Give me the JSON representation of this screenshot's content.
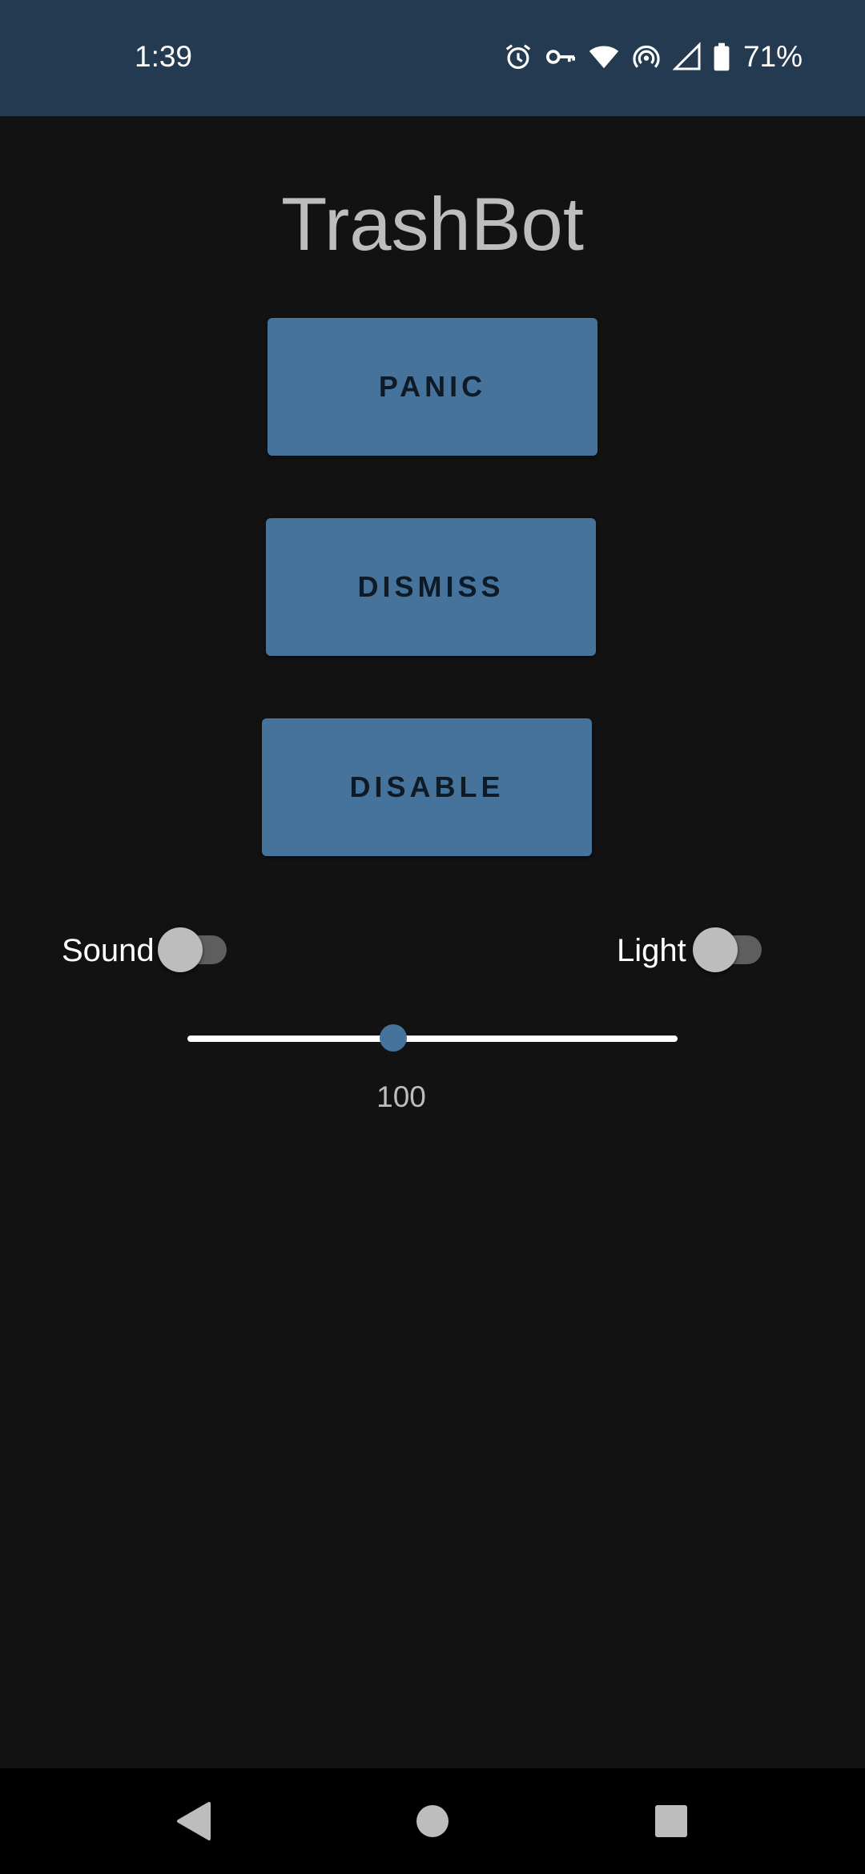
{
  "status_bar": {
    "time": "1:39",
    "battery": "71%",
    "icons": [
      "alarm-icon",
      "vpn-key-icon",
      "wifi-icon",
      "hotspot-icon",
      "signal-icon",
      "battery-icon"
    ]
  },
  "app": {
    "title": "TrashBot"
  },
  "buttons": {
    "panic": "PANIC",
    "dismiss": "DISMISS",
    "disable": "DISABLE"
  },
  "toggles": {
    "sound": {
      "label": "Sound",
      "on": false
    },
    "light": {
      "label": "Light",
      "on": false
    }
  },
  "slider": {
    "value_label": "100",
    "position_fraction": 0.42
  },
  "nav": {
    "icons": [
      "back-icon",
      "home-icon",
      "recents-icon"
    ]
  },
  "colors": {
    "status_bar": "#243a51",
    "background": "#121212",
    "accent": "#45739c"
  }
}
